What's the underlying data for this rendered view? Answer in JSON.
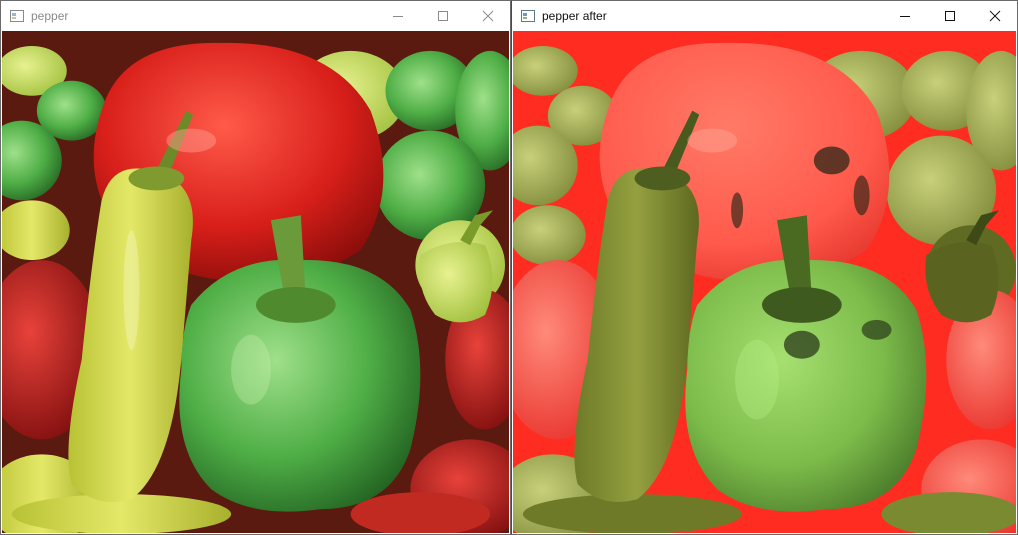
{
  "windows": [
    {
      "title": "pepper",
      "icon": "opencv-window-icon",
      "state": "inactive",
      "controls": [
        "minimize-icon",
        "maximize-icon",
        "close-icon"
      ],
      "image": "original peppers photograph: red, green and yellow bell peppers and chili peppers"
    },
    {
      "title": "pepper after",
      "icon": "opencv-window-icon",
      "state": "active",
      "controls": [
        "minimize-icon",
        "maximize-icon",
        "close-icon"
      ],
      "image": "processed peppers photograph with color channels altered: red background, olive and green peppers"
    }
  ],
  "colors": {
    "titlebar_bg": "#ffffff",
    "inactive_title": "#8a8a8a",
    "active_title": "#111111",
    "border": "#6b6b6b"
  }
}
